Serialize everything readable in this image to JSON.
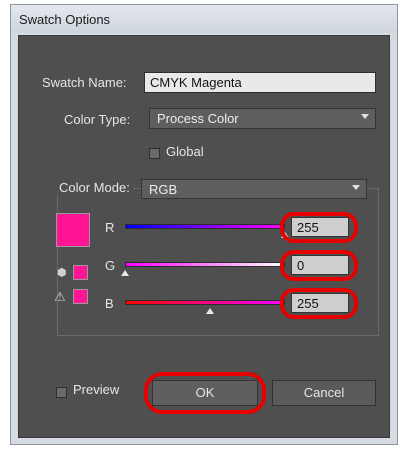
{
  "window": {
    "title": "Swatch Options"
  },
  "form": {
    "swatch_name_label": "Swatch Name:",
    "swatch_name_value": "CMYK Magenta",
    "color_type_label": "Color Type:",
    "color_type_value": "Process Color",
    "global_label": "Global",
    "color_mode_label": "Color Mode:",
    "color_mode_value": "RGB"
  },
  "channels": [
    {
      "label": "R",
      "value": "255"
    },
    {
      "label": "G",
      "value": "0"
    },
    {
      "label": "B",
      "value": "255"
    }
  ],
  "footer": {
    "preview_label": "Preview",
    "ok_label": "OK",
    "cancel_label": "Cancel"
  },
  "colors": {
    "swatch": "#ff1493",
    "highlight": "#e60000"
  },
  "icons": [
    "out-of-gamut-icon",
    "web-safe-warning-icon",
    "dropdown-arrow-icon",
    "slider-thumb-icon"
  ]
}
